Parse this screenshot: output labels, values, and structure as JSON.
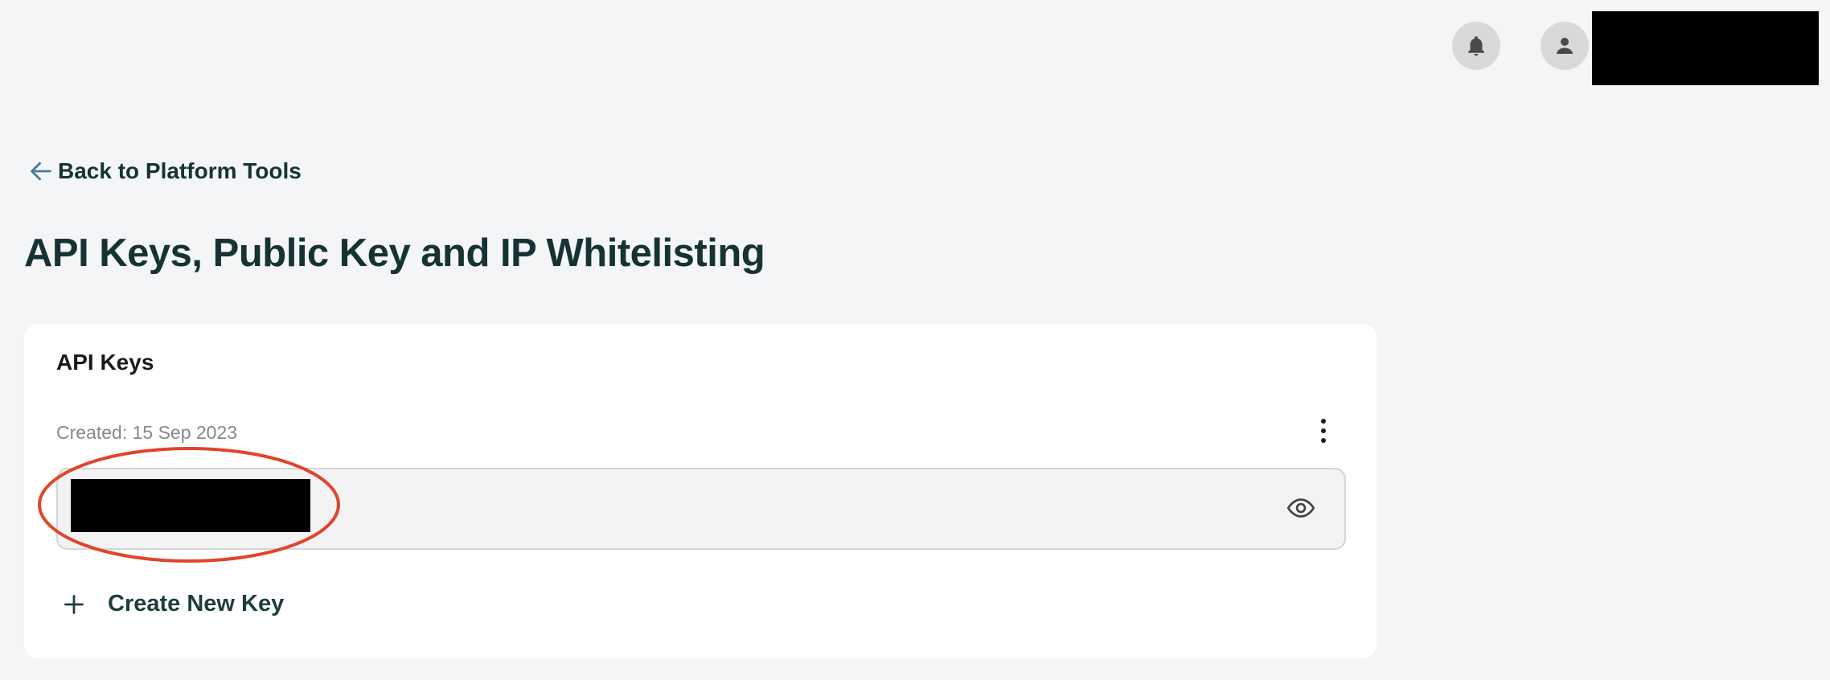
{
  "header": {
    "notification_icon": "bell-icon",
    "avatar_icon": "person-icon"
  },
  "nav": {
    "back_label": "Back to Platform Tools",
    "back_icon": "arrow-left-icon"
  },
  "page": {
    "title": "API Keys, Public Key and IP Whitelisting"
  },
  "api_keys_card": {
    "title": "API Keys",
    "created_label": "Created: 15 Sep 2023",
    "more_icon": "kebab-menu-icon",
    "reveal_icon": "eye-icon",
    "create_label": "Create New Key",
    "create_icon": "plus-icon"
  },
  "colors": {
    "background": "#f4f5f7",
    "text_dark": "#163333",
    "card": "#ffffff",
    "annotation_red": "#e0452b",
    "link_arrow": "#4a7a9a"
  }
}
